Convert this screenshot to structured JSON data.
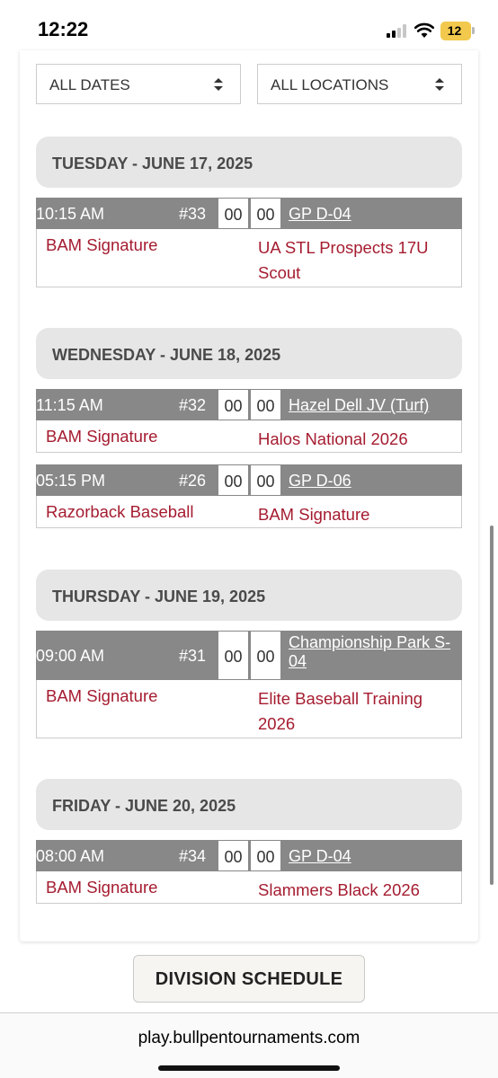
{
  "status_bar": {
    "time": "12:22",
    "battery": "12",
    "battery_color": "#f2c94c"
  },
  "filters": {
    "dates": "ALL DATES",
    "locations": "ALL LOCATIONS"
  },
  "days": [
    {
      "label": "TUESDAY - JUNE 17, 2025",
      "games": [
        {
          "time": "10:15 AM",
          "number": "#33",
          "score1": "00",
          "score2": "00",
          "location": "GP D-04",
          "team1": "BAM Signature",
          "team2": "UA STL Prospects 17U Scout"
        }
      ]
    },
    {
      "label": "WEDNESDAY - JUNE 18, 2025",
      "games": [
        {
          "time": "11:15 AM",
          "number": "#32",
          "score1": "00",
          "score2": "00",
          "location": "Hazel Dell JV (Turf)",
          "team1": "BAM Signature",
          "team2": "Halos National 2026"
        },
        {
          "time": "05:15 PM",
          "number": "#26",
          "score1": "00",
          "score2": "00",
          "location": "GP D-06",
          "team1": "Razorback Baseball",
          "team2": "BAM Signature"
        }
      ]
    },
    {
      "label": "THURSDAY - JUNE 19, 2025",
      "games": [
        {
          "time": "09:00 AM",
          "number": "#31",
          "score1": "00",
          "score2": "00",
          "location": "Championship Park S-04",
          "team1": "BAM Signature",
          "team2": "Elite Baseball Training 2026"
        }
      ]
    },
    {
      "label": "FRIDAY - JUNE 20, 2025",
      "games": [
        {
          "time": "08:00 AM",
          "number": "#34",
          "score1": "00",
          "score2": "00",
          "location": "GP D-04",
          "team1": "BAM Signature",
          "team2": "Slammers Black 2026"
        }
      ]
    }
  ],
  "division_button": "DIVISION SCHEDULE",
  "url": "play.bullpentournaments.com",
  "colors": {
    "team_text": "#a51c30",
    "game_header": "#888888",
    "day_header": "#e6e6e6"
  }
}
